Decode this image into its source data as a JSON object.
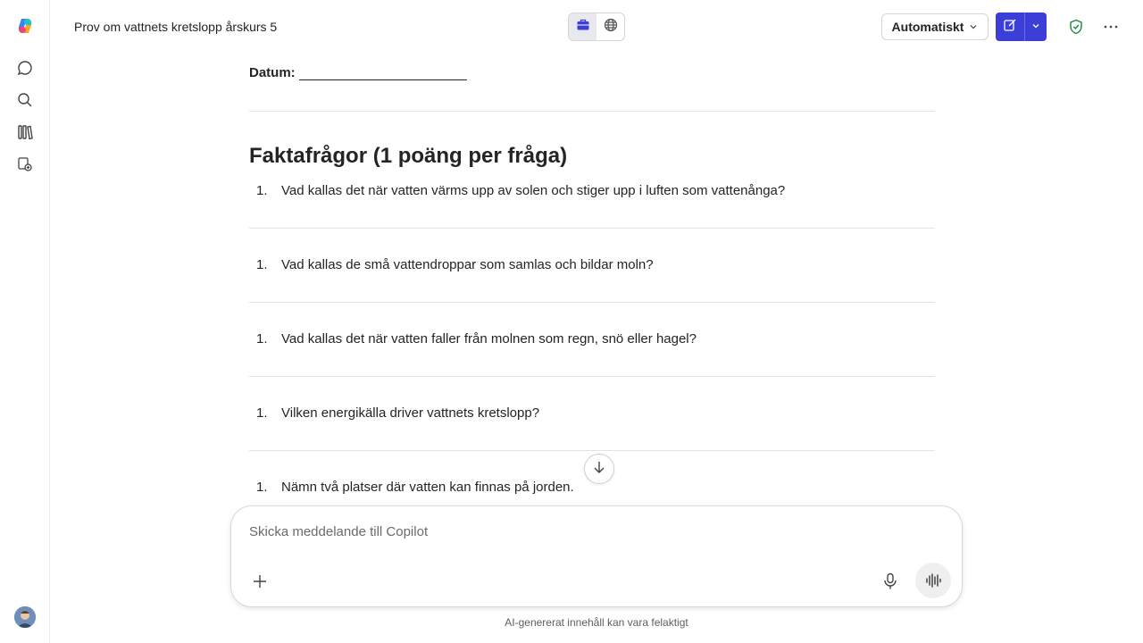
{
  "header": {
    "title": "Prov om vattnets kretslopp årskurs 5",
    "mode_selector_label": "Automatiskt"
  },
  "document": {
    "date_label": "Datum:",
    "section_title": "Faktafrågor (1 poäng per fråga)",
    "questions": [
      {
        "number": "1.",
        "text": "Vad kallas det när vatten värms upp av solen och stiger upp i luften som vattenånga?"
      },
      {
        "number": "1.",
        "text": "Vad kallas de små vattendroppar som samlas och bildar moln?"
      },
      {
        "number": "1.",
        "text": "Vad kallas det när vatten faller från molnen som regn, snö eller hagel?"
      },
      {
        "number": "1.",
        "text": "Vilken energikälla driver vattnets kretslopp?"
      },
      {
        "number": "1.",
        "text": "Nämn två platser där vatten kan finnas på jorden."
      }
    ]
  },
  "composer": {
    "placeholder": "Skicka meddelande till Copilot"
  },
  "footer": {
    "disclaimer": "AI-genererat innehåll kan vara felaktigt"
  },
  "colors": {
    "accent": "#3b3fd8",
    "shield": "#1e8a3c"
  },
  "icons": {
    "logo": "copilot-logo-icon",
    "chat": "chat-icon",
    "search": "search-icon",
    "library": "library-icon",
    "agents": "agents-icon",
    "work": "briefcase-icon",
    "web": "globe-icon",
    "new_chat": "compose-icon",
    "protection": "shield-check-icon",
    "more": "more-horizontal-icon",
    "add": "plus-icon",
    "microphone": "microphone-icon",
    "voice": "voice-waveform-icon",
    "scroll": "arrow-down-icon"
  }
}
